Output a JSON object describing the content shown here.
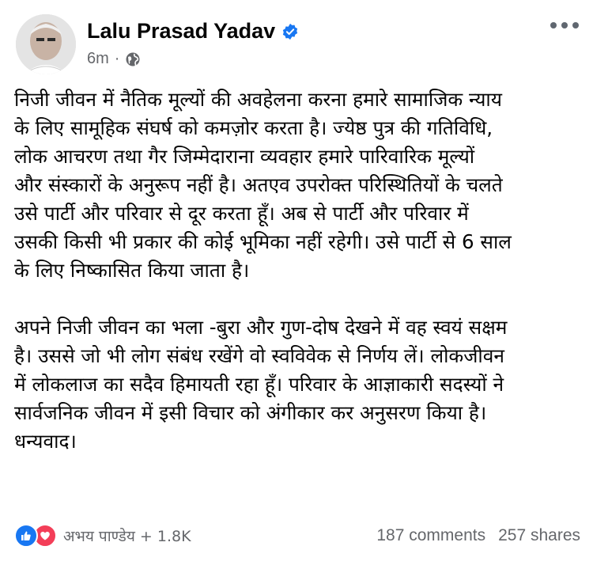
{
  "post": {
    "author": "Lalu Prasad Yadav",
    "time": "6m",
    "separator": "·",
    "privacy_icon": "globe-icon",
    "paragraph1": "निजी जीवन में नैतिक मूल्यों की अवहेलना करना हमारे सामाजिक न्याय\nके लिए सामूहिक संघर्ष को कमज़ोर करता है। ज्येष्ठ पुत्र की गतिविधि,\nलोक आचरण तथा गैर जिम्मेदाराना व्यवहार हमारे पारिवारिक मूल्यों\nऔर संस्कारों के अनुरूप नहीं है। अतएव उपरोक्त परिस्थितियों के चलते\nउसे पार्टी और परिवार से दूर करता हूँ। अब से पार्टी और परिवार में\nउसकी किसी भी प्रकार की कोई भूमिका नहीं रहेगी। उसे पार्टी से 6 साल\nके लिए निष्कासित किया जाता है।",
    "paragraph2": "अपने निजी जीवन का भला -बुरा और गुण-दोष देखने में वह स्वयं सक्षम\nहै। उससे जो भी लोग संबंध रखेंगे वो स्वविवेक से निर्णय लें। लोकजीवन\nमें लोकलाज का सदैव हिमायती रहा हूँ। परिवार के आज्ञाकारी सदस्यों ने\nसार्वजनिक जीवन में इसी विचार को अंगीकार कर अनुसरण किया है।\nधन्यवाद।"
  },
  "footer": {
    "reactions_text": "अभय पाण्डेय + 1.8K",
    "comments": "187 comments",
    "shares": "257 shares"
  },
  "colors": {
    "verified": "#1877f2",
    "like": "#1877f2",
    "love": "#f33e58",
    "meta_text": "#65676b"
  }
}
